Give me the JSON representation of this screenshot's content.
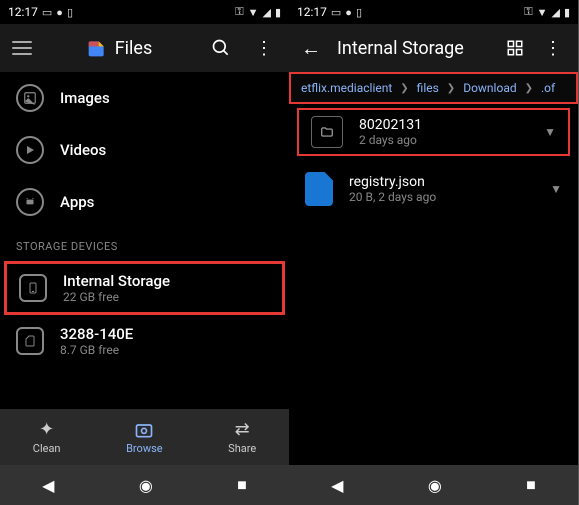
{
  "status": {
    "time": "12:17",
    "icons_left": [
      "▭",
      "●",
      "▯"
    ],
    "icons_right": [
      "⚿",
      "▼",
      "◢",
      "▮"
    ]
  },
  "left": {
    "app_title": "Files",
    "categories": {
      "images": "Images",
      "videos": "Videos",
      "apps": "Apps"
    },
    "section_header": "STORAGE DEVICES",
    "storage": [
      {
        "name": "Internal Storage",
        "sub": "22 GB free"
      },
      {
        "name": "3288-140E",
        "sub": "8.7 GB free"
      }
    ],
    "nav": {
      "clean": "Clean",
      "browse": "Browse",
      "share": "Share"
    }
  },
  "right": {
    "title": "Internal Storage",
    "breadcrumb": [
      "etflix.mediaclient",
      "files",
      "Download",
      ".of"
    ],
    "files": [
      {
        "name": "80202131",
        "sub": "2 days ago",
        "type": "folder"
      },
      {
        "name": "registry.json",
        "sub": "20 B, 2 days ago",
        "type": "json"
      }
    ]
  }
}
